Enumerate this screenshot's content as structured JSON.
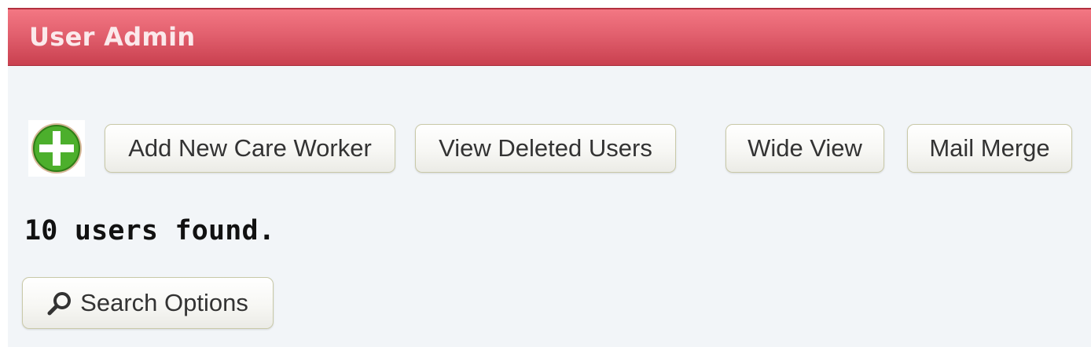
{
  "header": {
    "title": "User Admin",
    "color": "#e2606e"
  },
  "toolbar": {
    "add_icon": "add-circle-icon",
    "add_new_label": "Add New Care Worker",
    "view_deleted_label": "View Deleted Users",
    "wide_view_label": "Wide View",
    "mail_merge_label": "Mail Merge"
  },
  "results": {
    "count_text": "10 users found."
  },
  "search": {
    "icon": "search-icon",
    "label": "Search Options"
  }
}
